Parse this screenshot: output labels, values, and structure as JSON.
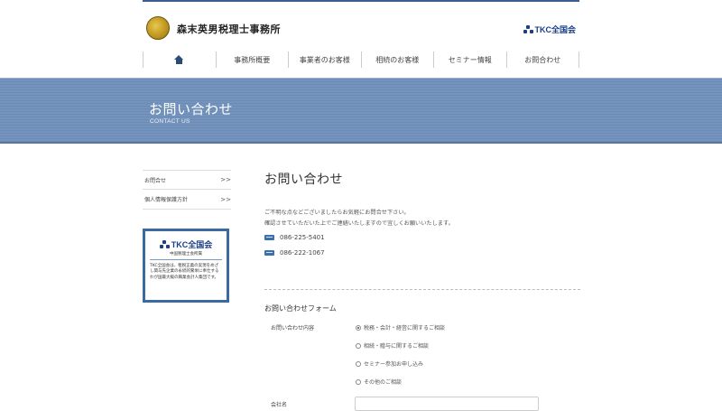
{
  "header": {
    "office_name": "森末英男税理士事務所",
    "tkc_logo": "TKC全国会",
    "logo_icon": "gold-seal-icon"
  },
  "nav": {
    "home_icon": "home-icon",
    "items": [
      "事務所概要",
      "事業者のお客様",
      "相続のお客様",
      "セミナー情報",
      "お問合わせ"
    ]
  },
  "hero": {
    "title": "お問い合わせ",
    "subtitle": "CONTACT US"
  },
  "sidebar": {
    "links": [
      {
        "label": "お問合せ",
        "arrow": ">>"
      },
      {
        "label": "個人情報保護方針",
        "arrow": ">>"
      }
    ],
    "tkc_box": {
      "logo": "TKC全国会",
      "sub": "中国税理士会所属",
      "body": "TKC全国会は、租税正義の実現をめざし関与先企業の永続的繁栄に奉仕するわが国最大級の職業会計人集団です。"
    }
  },
  "main": {
    "title": "お問い合わせ",
    "intro_line1": "ご不明な点などございましたらお気軽にお問合せ下さい。",
    "intro_line2": "確認させていただいた上でご連絡いたしますので宜しくお願いいたします。",
    "tel_label": "TEL",
    "tel": "086-225-5401",
    "fax_label": "FAX",
    "fax": "086-222-1067"
  },
  "form": {
    "title": "お問い合わせフォーム",
    "inquiry_label": "お問い合わせ内容",
    "options": [
      {
        "label": "税務・会計・経営に関するご相談",
        "checked": true
      },
      {
        "label": "相続・贈与に関するご相談",
        "checked": false
      },
      {
        "label": "セミナー参加お申し込み",
        "checked": false
      },
      {
        "label": "その他のご相談",
        "checked": false
      }
    ],
    "company_label": "会社名"
  },
  "colors": {
    "accent": "#3b6aa3",
    "hero_bg": "#6b8bb5",
    "tkc_blue": "#1b3e87"
  }
}
